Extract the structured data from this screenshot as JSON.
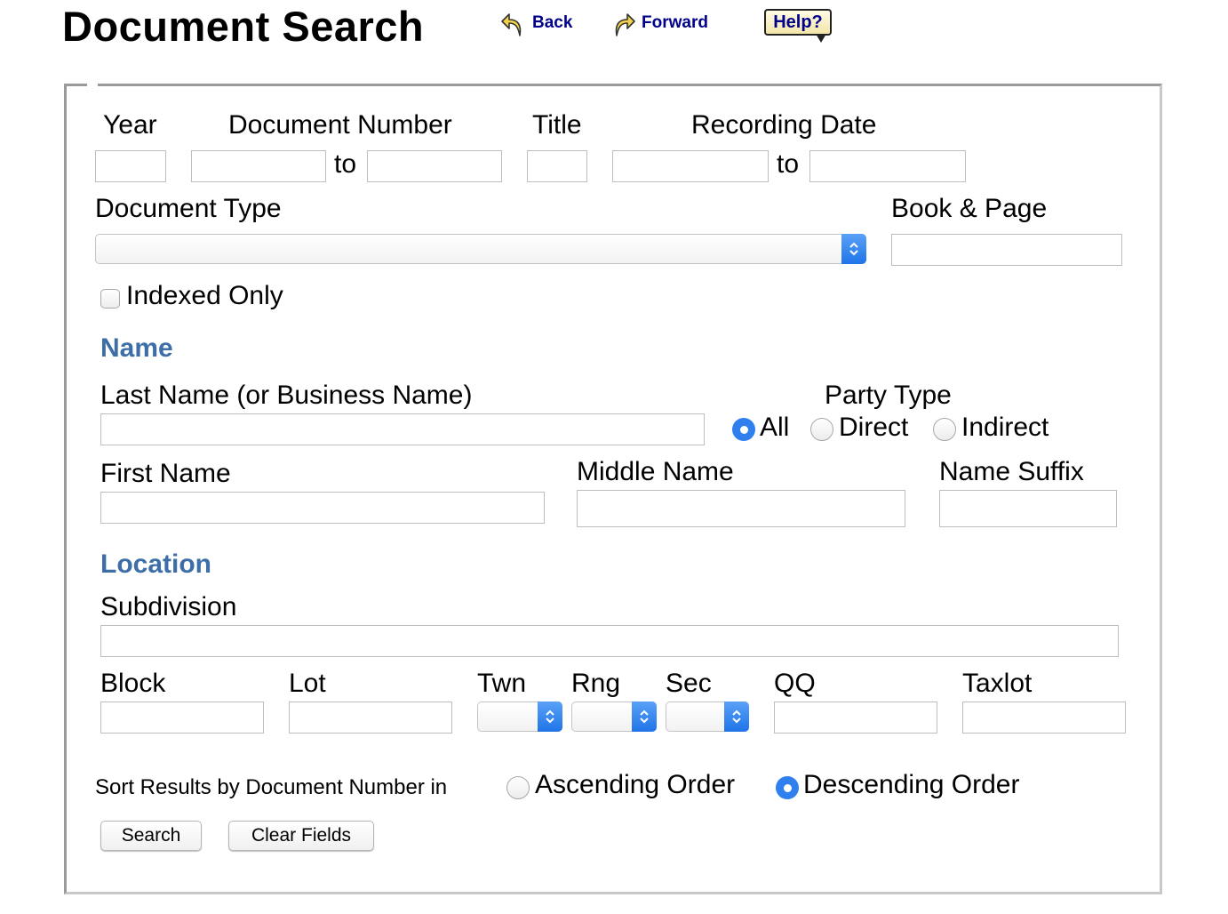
{
  "header": {
    "title": "Document Search",
    "back_label": "Back",
    "forward_label": "Forward",
    "help_label": "Help?"
  },
  "form": {
    "year_label": "Year",
    "doc_number_label": "Document Number",
    "title_label": "Title",
    "recording_date_label": "Recording Date",
    "to_label": "to",
    "document_type_label": "Document Type",
    "document_type_selected": "",
    "book_page_label": "Book & Page",
    "indexed_only_label": "Indexed Only",
    "indexed_only_checked": false
  },
  "name_section": {
    "heading": "Name",
    "last_name_label": "Last Name (or Business Name)",
    "party_type_label": "Party Type",
    "party_options": [
      "All",
      "Direct",
      "Indirect"
    ],
    "party_selected": "All",
    "first_name_label": "First Name",
    "middle_name_label": "Middle Name",
    "name_suffix_label": "Name Suffix"
  },
  "location_section": {
    "heading": "Location",
    "subdivision_label": "Subdivision",
    "block_label": "Block",
    "lot_label": "Lot",
    "twn_label": "Twn",
    "rng_label": "Rng",
    "sec_label": "Sec",
    "qq_label": "QQ",
    "taxlot_label": "Taxlot"
  },
  "sort": {
    "label": "Sort Results by Document Number in",
    "ascending_label": "Ascending Order",
    "descending_label": "Descending Order",
    "selected": "Descending Order"
  },
  "actions": {
    "search_label": "Search",
    "clear_label": "Clear Fields"
  },
  "colors": {
    "section_heading": "#3d6ea8",
    "nav_link": "#00008b",
    "radio_selected": "#2f80ee"
  },
  "icons": {
    "back": "back-arrow-icon",
    "forward": "forward-arrow-icon",
    "select": "select-chevron-icon"
  }
}
